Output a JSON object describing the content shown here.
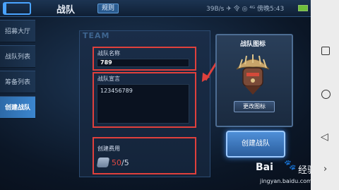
{
  "topbar": {
    "title": "战队",
    "rule_label": "规则",
    "status_text": "39B/s ✈ 令 ◎ ⁴ᴳ 傍晚5:43"
  },
  "sidebar": {
    "items": [
      {
        "label": "招募大厅",
        "active": false
      },
      {
        "label": "战队列表",
        "active": false
      },
      {
        "label": "筹备列表",
        "active": false
      },
      {
        "label": "创建战队",
        "active": true
      }
    ]
  },
  "main": {
    "watermark": "TEAM",
    "name_label": "战队名称",
    "name_value": "789",
    "declaration_label": "战队宣言",
    "declaration_value": "123456789",
    "cost_label": "创建费用",
    "cost_current": "50",
    "cost_separator": "/",
    "cost_total": "5"
  },
  "icon_panel": {
    "title": "战队图标",
    "change_label": "更改图标",
    "emblem_icon": "helmet-emblem-icon"
  },
  "create_button": "创建战队",
  "watermark": {
    "logo": "Bai",
    "paw": "🐾",
    "text": "经验",
    "url": "jingyan.baidu.com"
  },
  "colors": {
    "highlight": "#e0403c",
    "accent": "#3c86cf",
    "background": "#0b1626"
  }
}
